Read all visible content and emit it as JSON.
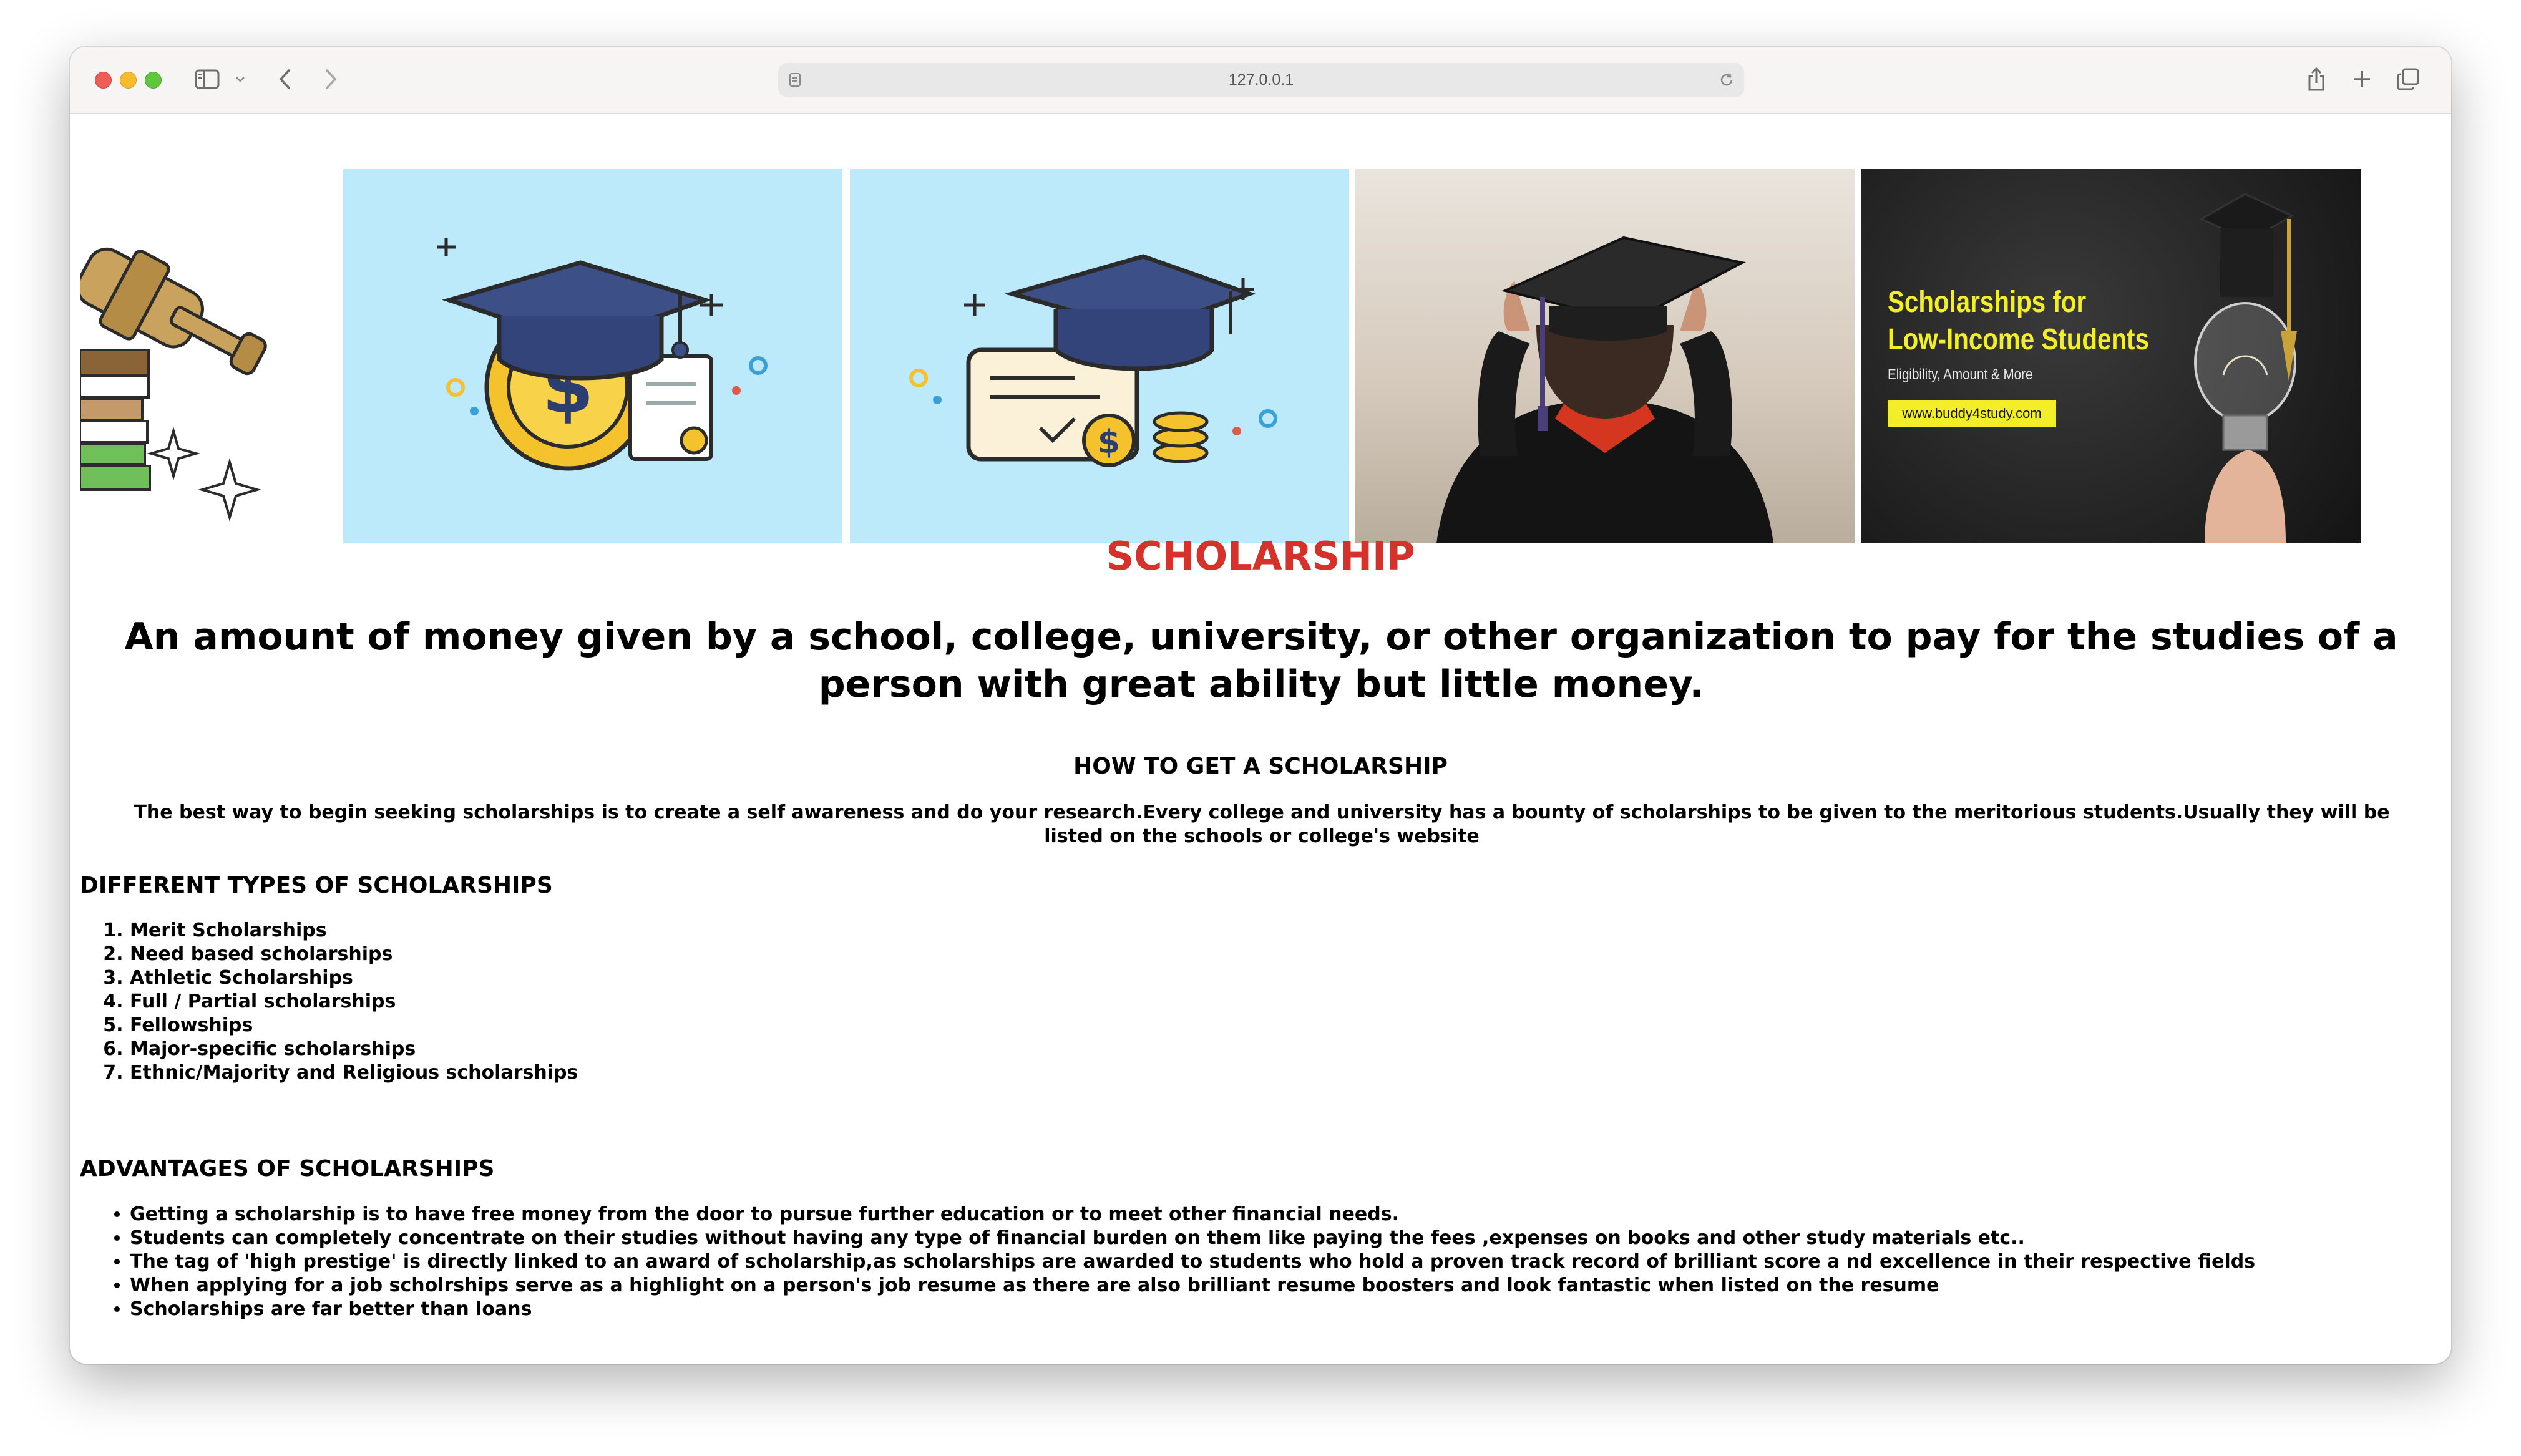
{
  "browser": {
    "url": "127.0.0.1"
  },
  "gallery": {
    "images": [
      {
        "name": "gavel-books-icon"
      },
      {
        "name": "graduation-cap-coin-icon"
      },
      {
        "name": "graduation-cap-certificate-icon"
      },
      {
        "name": "graduate-photo"
      },
      {
        "name": "low-income-scholarship-banner",
        "title_line1": "Scholarships for",
        "title_line2": "Low-Income Students",
        "subtitle": "Eligibility, Amount & More",
        "link": "www.buddy4study.com"
      }
    ]
  },
  "page": {
    "title": "SCHOLARSHIP",
    "definition": "An amount of money given by a school, college, university, or other organization to pay for the studies of a person with great ability but little money.",
    "how_heading": "HOW TO GET A SCHOLARSHIP",
    "how_paragraph": "The best way to begin seeking scholarships is to create a self awareness and do your research.Every college and university has a bounty of scholarships to be given to the meritorious students.Usually they will be listed on the schools or college's website",
    "types_heading": "DIFFERENT TYPES OF SCHOLARSHIPS",
    "types": [
      "Merit Scholarships",
      "Need based scholarships",
      "Athletic Scholarships",
      "Full / Partial scholarships",
      "Fellowships",
      "Major-specific scholarships",
      "Ethnic/Majority and Religious scholarships"
    ],
    "advantages_heading": "ADVANTAGES OF SCHOLARSHIPS",
    "advantages": [
      "Getting a scholarship is to have free money from the door to pursue further education or to meet other financial needs.",
      "Students can completely concentrate on their studies without having any type of financial burden on them like paying the fees ,expenses on books and other study materials etc..",
      "The tag of 'high prestige' is directly linked to an award of scholarship,as scholarships are awarded to students who hold a proven track record of brilliant score a nd excellence in their respective fields",
      "When applying for a job scholrships serve as a highlight on a person's job resume as there are also brilliant resume boosters and look fantastic when listed on the resume",
      "Scholarships are far better than loans"
    ]
  },
  "colors": {
    "title_red": "#d6322c",
    "tile_blue": "#bdeafa",
    "banner_yellow": "#f2ee2a"
  }
}
